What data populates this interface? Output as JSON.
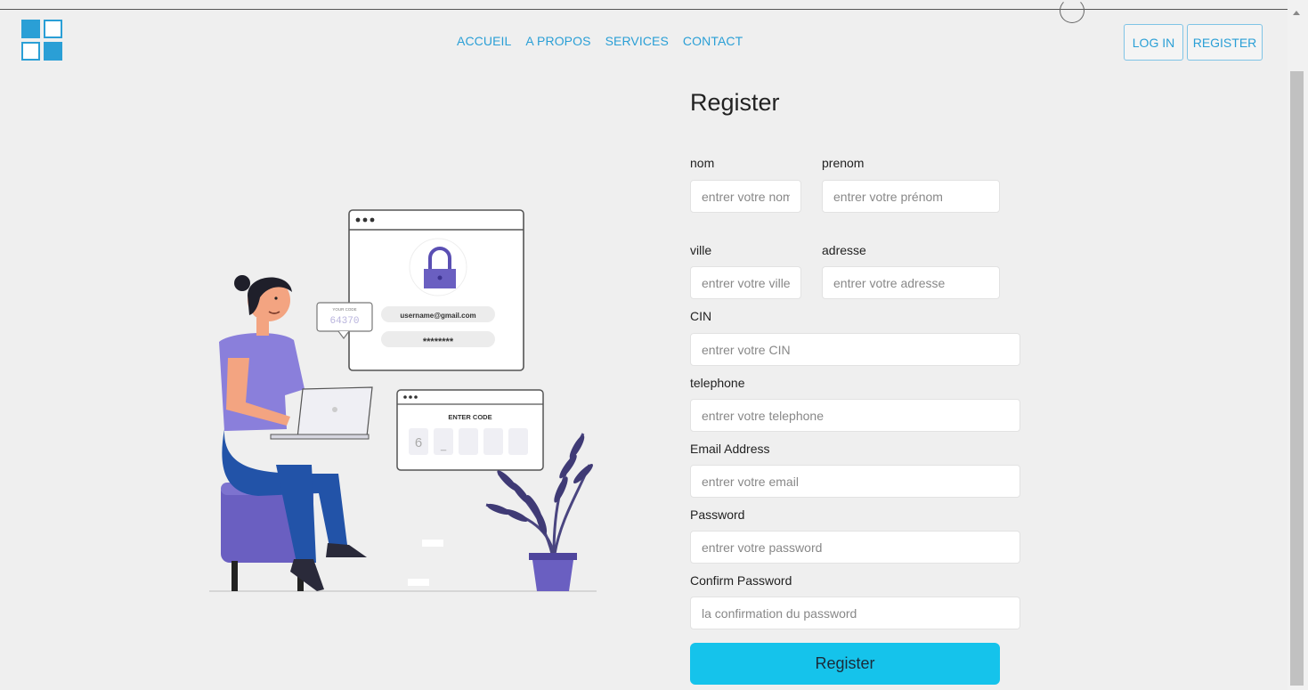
{
  "header": {
    "nav": [
      "ACCUEIL",
      "A PROPOS",
      "SERVICES",
      "CONTACT"
    ],
    "login_label": "LOG IN",
    "register_label": "REGISTER"
  },
  "form": {
    "title": "Register",
    "fields": {
      "nom": {
        "label": "nom",
        "placeholder": "entrer votre nom"
      },
      "prenom": {
        "label": "prenom",
        "placeholder": "entrer votre prénom"
      },
      "ville": {
        "label": "ville",
        "placeholder": "entrer votre ville"
      },
      "adresse": {
        "label": "adresse",
        "placeholder": "entrer votre adresse"
      },
      "cin": {
        "label": "CIN",
        "placeholder": "entrer votre CIN"
      },
      "telephone": {
        "label": "telephone",
        "placeholder": "entrer votre telephone"
      },
      "email": {
        "label": "Email Address",
        "placeholder": "entrer votre email"
      },
      "password": {
        "label": "Password",
        "placeholder": "entrer votre password"
      },
      "confirm": {
        "label": "Confirm Password",
        "placeholder": "la confirmation du password"
      }
    },
    "submit_label": "Register"
  },
  "illustration": {
    "email_text": "username@gmail.com",
    "password_mask": "********",
    "code_caption": "YOUR CODE",
    "code_value": "64370",
    "enter_code_title": "ENTER CODE",
    "code_first_digit": "6",
    "code_cursor": "_"
  },
  "colors": {
    "accent": "#2a9fd6",
    "button": "#15c3eb",
    "illustration": "#6a5fc1"
  }
}
